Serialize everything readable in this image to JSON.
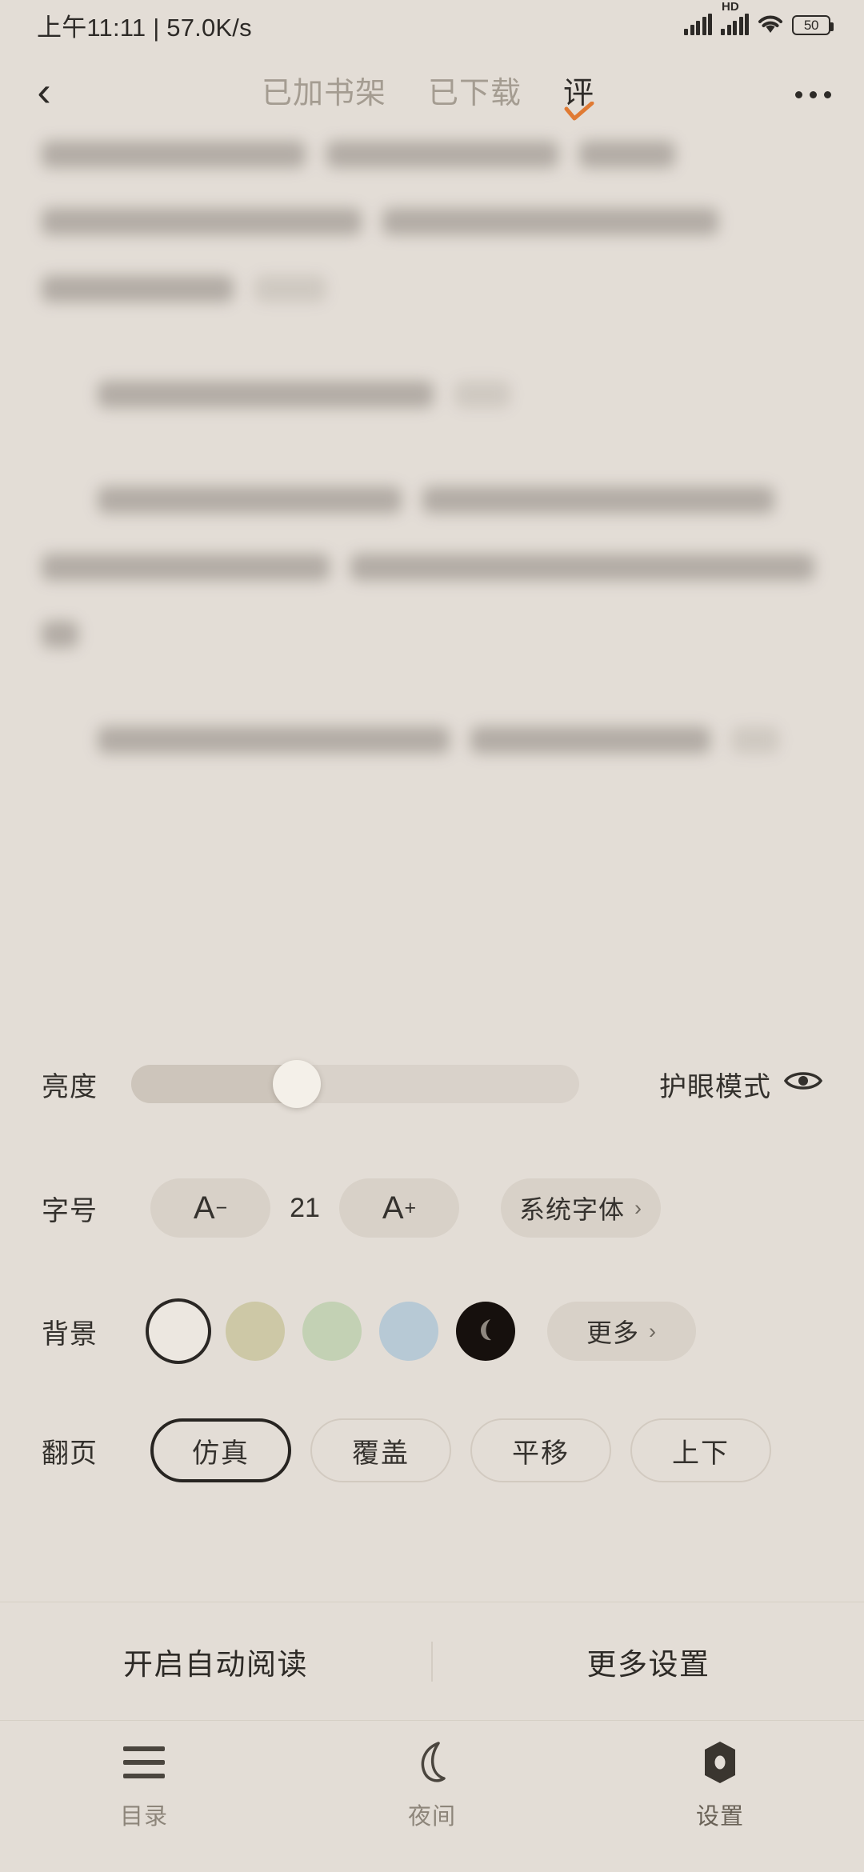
{
  "status_bar": {
    "time": "上午11:11",
    "separator": "|",
    "net_speed": "57.0K/s",
    "hd_label": "HD",
    "battery_level": "50",
    "icons": [
      "signal-icon",
      "signal-hd-icon",
      "wifi-icon",
      "battery-icon"
    ]
  },
  "top_nav": {
    "back_icon": "back-chevron-icon",
    "more_icon": "overflow-menu-icon",
    "tabs": [
      {
        "label": "已加书架",
        "active": false
      },
      {
        "label": "已下载",
        "active": false
      },
      {
        "label": "评",
        "active": true,
        "mark": "check-icon"
      }
    ],
    "active_mark_color": "#e07a33"
  },
  "reader_content": {
    "blurred": true,
    "note": "blurred body text of the e-book page"
  },
  "settings": {
    "brightness": {
      "label": "亮度",
      "value_percent": 37,
      "eye_mode_label": "护眼模式",
      "eye_mode_icon": "eye-icon"
    },
    "font_size": {
      "label": "字号",
      "decrease_label": "A",
      "decrease_sup": "−",
      "value": "21",
      "increase_label": "A",
      "increase_sup": "+",
      "system_font_label": "系统字体",
      "chevron": "›"
    },
    "background": {
      "label": "背景",
      "swatches": [
        {
          "name": "white",
          "color": "#ece7e0",
          "selected": true
        },
        {
          "name": "beige",
          "color": "#cdc8a6",
          "selected": false
        },
        {
          "name": "green",
          "color": "#c3d1b4",
          "selected": false
        },
        {
          "name": "blue",
          "color": "#b7c9d5",
          "selected": false
        },
        {
          "name": "dark-night",
          "color": "#16100d",
          "selected": false,
          "icon": "moon-icon"
        }
      ],
      "more_label": "更多",
      "chevron": "›"
    },
    "page_turn": {
      "label": "翻页",
      "options": [
        {
          "label": "仿真",
          "selected": true
        },
        {
          "label": "覆盖",
          "selected": false
        },
        {
          "label": "平移",
          "selected": false
        },
        {
          "label": "上下",
          "selected": false
        }
      ]
    }
  },
  "footer_actions": {
    "auto_read": "开启自动阅读",
    "more_settings": "更多设置"
  },
  "tab_bar": {
    "tabs": [
      {
        "label": "目录",
        "icon": "hamburger-menu-icon",
        "active": false
      },
      {
        "label": "夜间",
        "icon": "moon-icon",
        "active": false
      },
      {
        "label": "设置",
        "icon": "gear-hex-icon",
        "active": true
      }
    ]
  },
  "colors": {
    "page_bg": "#e3ddd6",
    "text_primary": "#2d2a27",
    "text_muted": "#a49c91",
    "accent": "#e07a33",
    "pill_bg": "#d8d1c8"
  }
}
